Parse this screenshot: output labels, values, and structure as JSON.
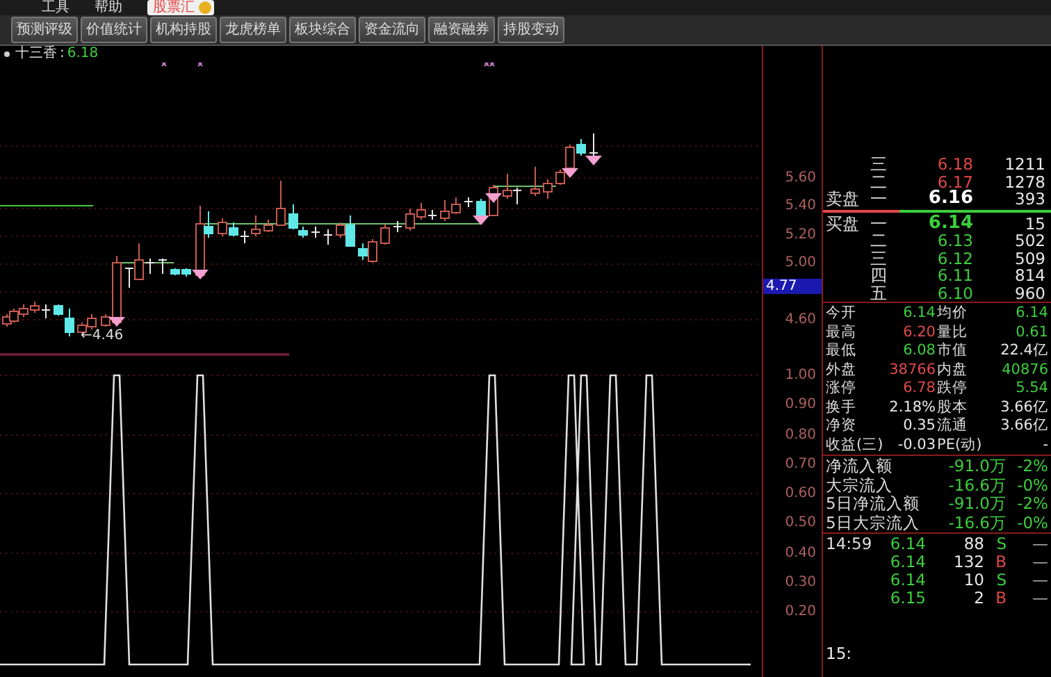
{
  "menu": [
    {
      "label": "工具"
    },
    {
      "label": "帮助"
    }
  ],
  "badge": {
    "label": "股票汇"
  },
  "tabs": [
    {
      "label": "预测评级",
      "selected": false
    },
    {
      "label": "价值统计",
      "selected": false
    },
    {
      "label": "机构持股",
      "selected": false
    },
    {
      "label": "龙虎榜单",
      "selected": false
    },
    {
      "label": "板块综合",
      "selected": false
    },
    {
      "label": "资金流向",
      "selected": false
    },
    {
      "label": "融资融券",
      "selected": false
    },
    {
      "label": "持股变动",
      "selected": false
    }
  ],
  "indicator": {
    "name": "十三香",
    "separator": ":",
    "value": "6.18"
  },
  "low_marker": "←4.46",
  "price_axis": {
    "ticks": [
      "5.60",
      "5.40",
      "5.20",
      "5.00",
      "4.60"
    ],
    "current": "4.77"
  },
  "signal_axis": {
    "ticks": [
      "1.00",
      "0.90",
      "0.80",
      "0.70",
      "0.60",
      "0.50",
      "0.40",
      "0.30",
      "0.20"
    ]
  },
  "order_book": {
    "asks": [
      {
        "rank": "三",
        "price": "6.18",
        "volume": "1211",
        "best": false
      },
      {
        "rank": "二",
        "price": "6.17",
        "volume": "1278",
        "best": false
      },
      {
        "side": "卖盘",
        "rank": "一",
        "price": "6.16",
        "volume": "393",
        "best": true
      }
    ],
    "bids": [
      {
        "side": "买盘",
        "rank": "一",
        "price": "6.14",
        "volume": "15",
        "best": true
      },
      {
        "rank": "二",
        "price": "6.13",
        "volume": "502",
        "best": false
      },
      {
        "rank": "三",
        "price": "6.12",
        "volume": "509",
        "best": false
      },
      {
        "rank": "四",
        "price": "6.11",
        "volume": "814",
        "best": false
      },
      {
        "rank": "五",
        "price": "6.10",
        "volume": "960",
        "best": false
      }
    ]
  },
  "stats": [
    [
      {
        "label": "今开",
        "value": "6.14",
        "color": "#3ccf3c"
      },
      {
        "label": "均价",
        "value": "6.14",
        "color": "#3ccf3c"
      }
    ],
    [
      {
        "label": "最高",
        "value": "6.20",
        "color": "#e04848"
      },
      {
        "label": "量比",
        "value": "0.61",
        "color": "#3ccf3c"
      }
    ],
    [
      {
        "label": "最低",
        "value": "6.08",
        "color": "#3ccf3c"
      },
      {
        "label": "市值",
        "value": "22.4亿",
        "color": "#e8e8e8"
      }
    ],
    [
      {
        "label": "外盘",
        "value": "38766",
        "color": "#e04848"
      },
      {
        "label": "内盘",
        "value": "40876",
        "color": "#3ccf3c"
      }
    ],
    [
      {
        "label": "涨停",
        "value": "6.78",
        "color": "#e04848"
      },
      {
        "label": "跌停",
        "value": "5.54",
        "color": "#3ccf3c"
      }
    ],
    [
      {
        "label": "换手",
        "value": "2.18%",
        "color": "#e8e8e8"
      },
      {
        "label": "股本",
        "value": "3.66亿",
        "color": "#e8e8e8"
      }
    ],
    [
      {
        "label": "净资",
        "value": "0.35",
        "color": "#e8e8e8"
      },
      {
        "label": "流通",
        "value": "3.66亿",
        "color": "#e8e8e8"
      }
    ],
    [
      {
        "label": "收益(三)",
        "value": "-0.03",
        "color": "#e8e8e8"
      },
      {
        "label": "PE(动)",
        "value": "-",
        "color": "#e8e8e8"
      }
    ]
  ],
  "flows": [
    {
      "label": "净流入额",
      "amount": "-91.0万",
      "percent": "-2%"
    },
    {
      "label": "大宗流入",
      "amount": "-16.6万",
      "percent": "-0%"
    },
    {
      "label": "5日净流入额",
      "amount": "-91.0万",
      "percent": "-2%"
    },
    {
      "label": "5日大宗流入",
      "amount": "-16.6万",
      "percent": "-0%"
    }
  ],
  "trades": [
    {
      "time": "14:59",
      "price": "6.14",
      "volume": "88",
      "side": "S",
      "color": "#3ccf3c",
      "flag": "—"
    },
    {
      "price": "6.14",
      "volume": "132",
      "side": "B",
      "color": "#e04848",
      "flag": "—"
    },
    {
      "price": "6.14",
      "volume": "10",
      "side": "S",
      "color": "#3ccf3c",
      "flag": "—"
    },
    {
      "price": "6.15",
      "volume": "2",
      "side": "B",
      "color": "#e04848",
      "flag": "—"
    }
  ],
  "footer_time": "15:"
}
